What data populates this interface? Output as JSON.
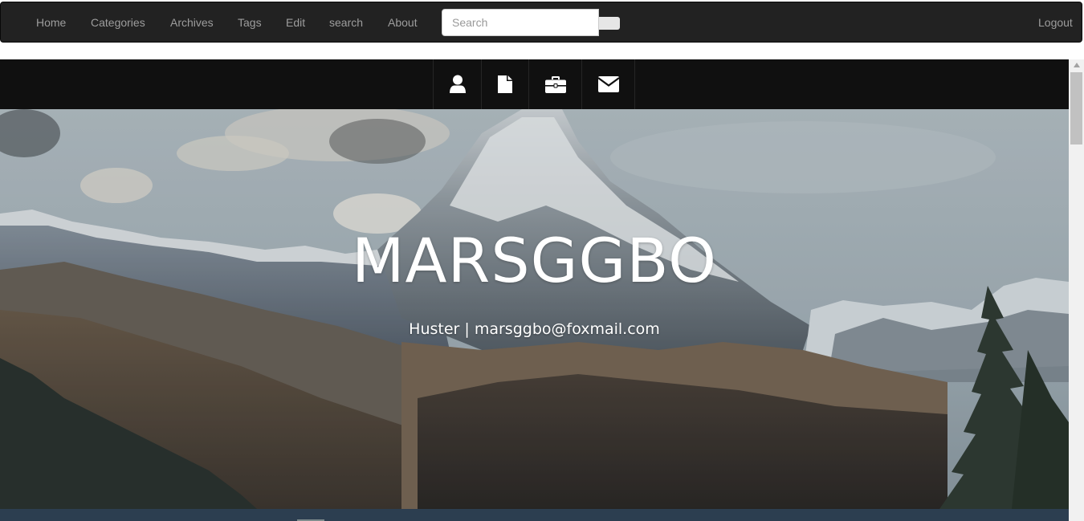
{
  "navbar": {
    "links": [
      {
        "label": "Home"
      },
      {
        "label": "Categories"
      },
      {
        "label": "Archives"
      },
      {
        "label": "Tags"
      },
      {
        "label": "Edit"
      },
      {
        "label": "search"
      },
      {
        "label": "About"
      }
    ],
    "search": {
      "placeholder": "Search",
      "value": ""
    },
    "logout_label": "Logout"
  },
  "icon_bar": {
    "items": [
      {
        "icon": "user-icon"
      },
      {
        "icon": "file-icon"
      },
      {
        "icon": "briefcase-icon"
      },
      {
        "icon": "envelope-icon"
      }
    ]
  },
  "hero": {
    "title": "MARSGGBO",
    "subtitle": "Huster | marsggbo@foxmail.com"
  },
  "colors": {
    "navbar_bg": "#222222",
    "nav_text": "#9d9d9d",
    "iconbar_bg": "#101010",
    "hero_text": "#ffffff",
    "bottom_strip": "#2c3e50"
  }
}
